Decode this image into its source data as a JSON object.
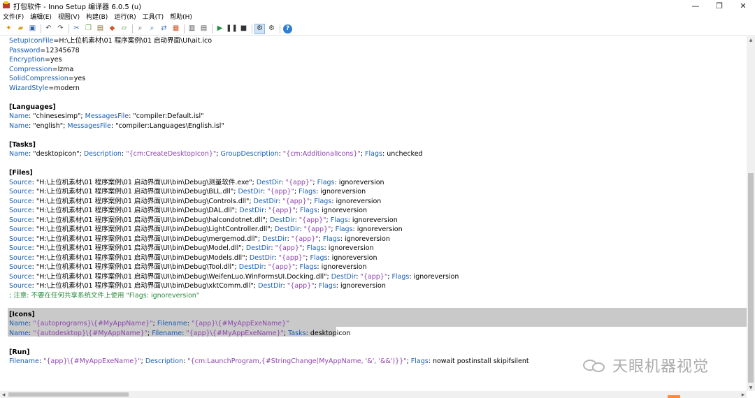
{
  "window": {
    "title": "打包软件 - Inno Setup 编译器 6.0.5 (u)",
    "minimize": "—",
    "maximize": "❐",
    "close": "✕"
  },
  "menu": [
    "文件(F)",
    "编辑(E)",
    "视图(V)",
    "构建(B)",
    "运行(R)",
    "工具(T)",
    "帮助(H)"
  ],
  "toolbar_icons": [
    "new-file-icon",
    "open-icon",
    "save-icon",
    "undo-icon",
    "redo-icon",
    "cut-icon",
    "copy-icon",
    "paste-icon",
    "delete-icon",
    "select-all-icon",
    "find-icon",
    "find-next-icon",
    "replace-icon",
    "goto-icon",
    "compile-icon",
    "run-icon",
    "pause-icon",
    "stop-icon",
    "debug-icon",
    "settings-icon",
    "help-icon"
  ],
  "watermark": "天眼机器视觉",
  "code": {
    "setup_icon": {
      "k": "SetupIconFile",
      "v": "H:\\上位机素材\\01 程序案例\\01 启动界面\\UI\\ait.ico"
    },
    "password": {
      "k": "Password",
      "v": "12345678"
    },
    "encryption": {
      "k": "Encryption",
      "v": "yes"
    },
    "compression": {
      "k": "Compression",
      "v": "lzma"
    },
    "solid": {
      "k": "SolidCompression",
      "v": "yes"
    },
    "wizard": {
      "k": "WizardStyle",
      "v": "modern"
    },
    "sec_languages": "[Languages]",
    "lang1": {
      "name": "\"chinesesimp\"",
      "msg": "\"compiler:Default.isl\""
    },
    "lang2": {
      "name": "\"english\"",
      "msg": "\"compiler:Languages\\English.isl\""
    },
    "sec_tasks": "[Tasks]",
    "task1": {
      "name": "\"desktopicon\"",
      "desc": "\"{cm:CreateDesktopIcon}\"",
      "group": "\"{cm:AdditionalIcons}\"",
      "flags": "unchecked"
    },
    "sec_files": "[Files]",
    "files": [
      {
        "src": "\"H:\\上位机素材\\01 程序案例\\01 启动界面\\UI\\bin\\Debug\\测量软件.exe\"",
        "extra": ""
      },
      {
        "src": "\"H:\\上位机素材\\01 程序案例\\01 启动界面\\UI\\bin\\Debug\\BLL.dll\"",
        "extra": ""
      },
      {
        "src": "\"H:\\上位机素材\\01 程序案例\\01 启动界面\\UI\\bin\\Debug\\Controls.dll\"",
        "extra": ""
      },
      {
        "src": "\"H:\\上位机素材\\01 程序案例\\01 启动界面\\UI\\bin\\Debug\\DAL.dll\"",
        "extra": ""
      },
      {
        "src": "\"H:\\上位机素材\\01 程序案例\\01 启动界面\\UI\\bin\\Debug\\halcondotnet.dll\"",
        "extra": ""
      },
      {
        "src": "\"H:\\上位机素材\\01 程序案例\\01 启动界面\\UI\\bin\\Debug\\LightController.dll\"",
        "extra": ""
      },
      {
        "src": "\"H:\\上位机素材\\01 程序案例\\01 启动界面\\UI\\bin\\Debug\\mergemod.dll\"",
        "extra": ""
      },
      {
        "src": "\"H:\\上位机素材\\01 程序案例\\01 启动界面\\UI\\bin\\Debug\\Model.dll\"",
        "extra": ""
      },
      {
        "src": "\"H:\\上位机素材\\01 程序案例\\01 启动界面\\UI\\bin\\Debug\\Models.dll\"",
        "extra": ""
      },
      {
        "src": "\"H:\\上位机素材\\01 程序案例\\01 启动界面\\UI\\bin\\Debug\\Tool.dll\"",
        "extra": ""
      },
      {
        "src": "\"H:\\上位机素材\\01 程序案例\\01 启动界面\\UI\\bin\\Debug\\WeifenLuo.WinFormsUI.Docking.dll\"",
        "extra": ""
      },
      {
        "src": "\"H:\\上位机素材\\01 程序案例\\01 启动界面\\UI\\bin\\Debug\\xktComm.dll\"",
        "extra": ""
      }
    ],
    "files_destdir": "\"{app}\"",
    "files_flags": "ignoreversion",
    "files_comment": "; 注意: 不要在任何共享系统文件上使用 \"Flags: ignoreversion\"",
    "sec_icons": "[Icons]",
    "icon1": {
      "name": "\"{autoprograms}\\{#MyAppName}\"",
      "file": "\"{app}\\{#MyAppExeName}\""
    },
    "icon2": {
      "name": "\"{autodesktop}\\{#MyAppName}\"",
      "file": "\"{app}\\{#MyAppExeName}\"",
      "tasks": "desktopicon"
    },
    "sec_run": "[Run]",
    "run1": {
      "file": "\"{app}\\{#MyAppExeName}\"",
      "desc": "\"{cm:LaunchProgram,{#StringChange(MyAppName, '&', '&&')}}\"",
      "flags": "nowait postinstall skipifsilent"
    },
    "labels": {
      "name": "Name",
      "messagesfile": "MessagesFile",
      "description": "Description",
      "groupdescription": "GroupDescription",
      "flags": "Flags",
      "source": "Source",
      "destdir": "DestDir",
      "filename": "Filename",
      "tasks": "Tasks",
      "colon": ": ",
      "semi": "; ",
      "eq": "="
    }
  }
}
